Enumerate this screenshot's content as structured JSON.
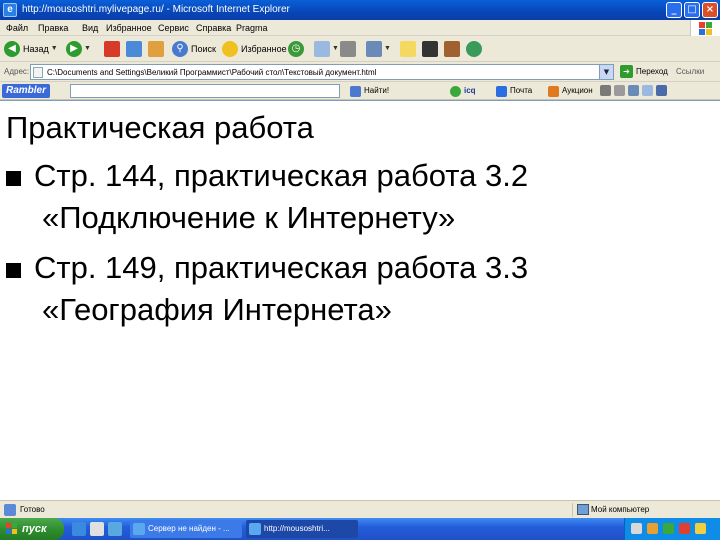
{
  "window": {
    "title": "http://mousoshtri.mylivepage.ru/ - Microsoft Internet Explorer",
    "app_icon": "e",
    "minimize": "_",
    "maximize": "□",
    "close": "×"
  },
  "menu": {
    "items": [
      "Файл",
      "Правка",
      "Вид",
      "Избранное",
      "Сервис",
      "Справка",
      "Pragma"
    ]
  },
  "toolbar": {
    "back_label": "Назад",
    "search_label": "Поиск",
    "favorites_label": "Избранное"
  },
  "address": {
    "label": "Адрес:",
    "url": "C:\\Documents and Settings\\Великий Программист\\Рабочий стол\\Текстовый документ.html",
    "go_label": "Переход",
    "links_label": "Ссылки"
  },
  "rambler": {
    "logo": "Rambler",
    "find_label": "Найти!",
    "mail_label": "Почта",
    "auction_label": "Аукцион",
    "icq_label": "icq"
  },
  "content": {
    "title": "Практическая работа",
    "items": [
      {
        "line1": "Стр. 144, практическая работа 3.2",
        "line2": "«Подключение к Интернету»"
      },
      {
        "line1": "Стр. 149, практическая работа 3.3",
        "line2": "«География Интернета»"
      }
    ]
  },
  "status": {
    "text": "Готово",
    "zone": "Мой компьютер"
  },
  "taskbar": {
    "start_label": "пуск",
    "tasks": [
      "Сервер не найден - ...",
      "http://mousoshtri..."
    ]
  },
  "colors": {
    "titlebar": "#0846b8",
    "taskbar": "#245edb",
    "start": "#2f8f2f"
  }
}
